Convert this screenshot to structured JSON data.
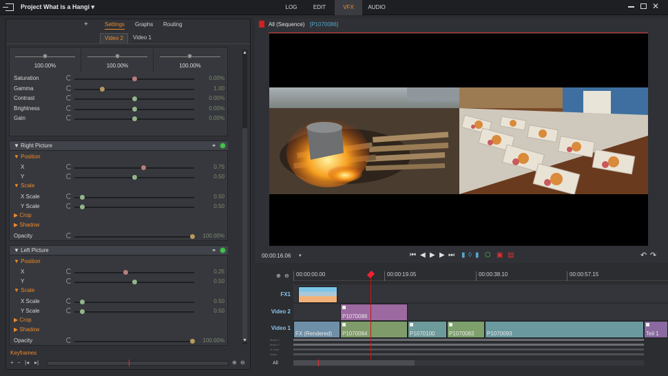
{
  "topbar": {
    "project_title": "Project What is a Hangi ▾",
    "modes": [
      "LOG",
      "EDIT",
      "VFX",
      "AUDIO"
    ],
    "active_mode": "VFX",
    "close_glyph": "✕"
  },
  "left": {
    "plus": "+",
    "tabs": [
      "Settings",
      "Graphs",
      "Routing"
    ],
    "video_tabs": [
      "Video 2",
      "Video 1"
    ],
    "wheels": [
      "100.00%",
      "100.00%",
      "100.00%"
    ],
    "color_params": [
      {
        "label": "Saturation",
        "value": "0.00%",
        "pos": 0.5,
        "knob": "red"
      },
      {
        "label": "Gamma",
        "value": "1.00",
        "pos": 0.22,
        "knob": "gold"
      },
      {
        "label": "Contrast",
        "value": "0.00%",
        "pos": 0.5,
        "knob": "green"
      },
      {
        "label": "Brightness",
        "value": "0.00%",
        "pos": 0.5,
        "knob": "green"
      },
      {
        "label": "Gain",
        "value": "0.00%",
        "pos": 0.5,
        "knob": "green"
      }
    ],
    "right_picture": {
      "title": "Right Picture",
      "position_label": "Position",
      "x_label": "X",
      "x_value": "0.75",
      "x_pos": 0.58,
      "y_label": "Y",
      "y_value": "0.50",
      "y_pos": 0.5,
      "scale_label": "Scale",
      "xs_label": "X Scale",
      "xs_value": "0.50",
      "xs_pos": 0.05,
      "ys_label": "Y Scale",
      "ys_value": "0.50",
      "ys_pos": 0.05,
      "crop_label": "Crop",
      "shadow_label": "Shadow",
      "opacity_label": "Opacity",
      "opacity_value": "100.00%",
      "opacity_pos": 1.0
    },
    "left_picture": {
      "title": "Left Picture",
      "position_label": "Position",
      "x_label": "X",
      "x_value": "0.25",
      "x_pos": 0.42,
      "y_label": "Y",
      "y_value": "0.50",
      "y_pos": 0.5,
      "scale_label": "Scale",
      "xs_label": "X Scale",
      "xs_value": "0.50",
      "xs_pos": 0.05,
      "ys_label": "Y Scale",
      "ys_value": "0.50",
      "ys_pos": 0.05,
      "crop_label": "Crop",
      "shadow_label": "Shadow",
      "opacity_label": "Opacity",
      "opacity_value": "100.00%",
      "opacity_pos": 1.0
    },
    "keyframes_label": "Keyframes",
    "kf_buttons": [
      "+",
      "−",
      "|◂",
      "▸|"
    ]
  },
  "viewer": {
    "sequence_label": "All (Sequence)",
    "clip_label": "[P1070086]",
    "timecode": "00:00:16.06",
    "transport": [
      "⏮",
      "◀",
      "▶",
      "▶",
      "⏭"
    ]
  },
  "timeline": {
    "ruler": [
      "00:00:00.00",
      "00:00:19.05",
      "00:00:38.10",
      "00:00:57.15"
    ],
    "tracks": [
      {
        "label": "FX1"
      },
      {
        "label": "Video 2"
      },
      {
        "label": "Video 1"
      }
    ],
    "clips_video2": [
      {
        "name": "P1070086"
      }
    ],
    "clips_video1": [
      {
        "name": "FX (Rendered)"
      },
      {
        "name": "P1070064"
      },
      {
        "name": "P1070100"
      },
      {
        "name": "P1070083"
      },
      {
        "name": "P1070093"
      },
      {
        "name": "Teil 1"
      }
    ],
    "mini_tracks": [
      "Music 1",
      "Music 2",
      "O-Tone",
      "Ahtse"
    ],
    "all_label": "All"
  },
  "colors": {
    "accent": "#f08a2c",
    "active_led": "#3ec64a",
    "playhead": "#cc1111",
    "track_label": "#8ec2e8"
  }
}
